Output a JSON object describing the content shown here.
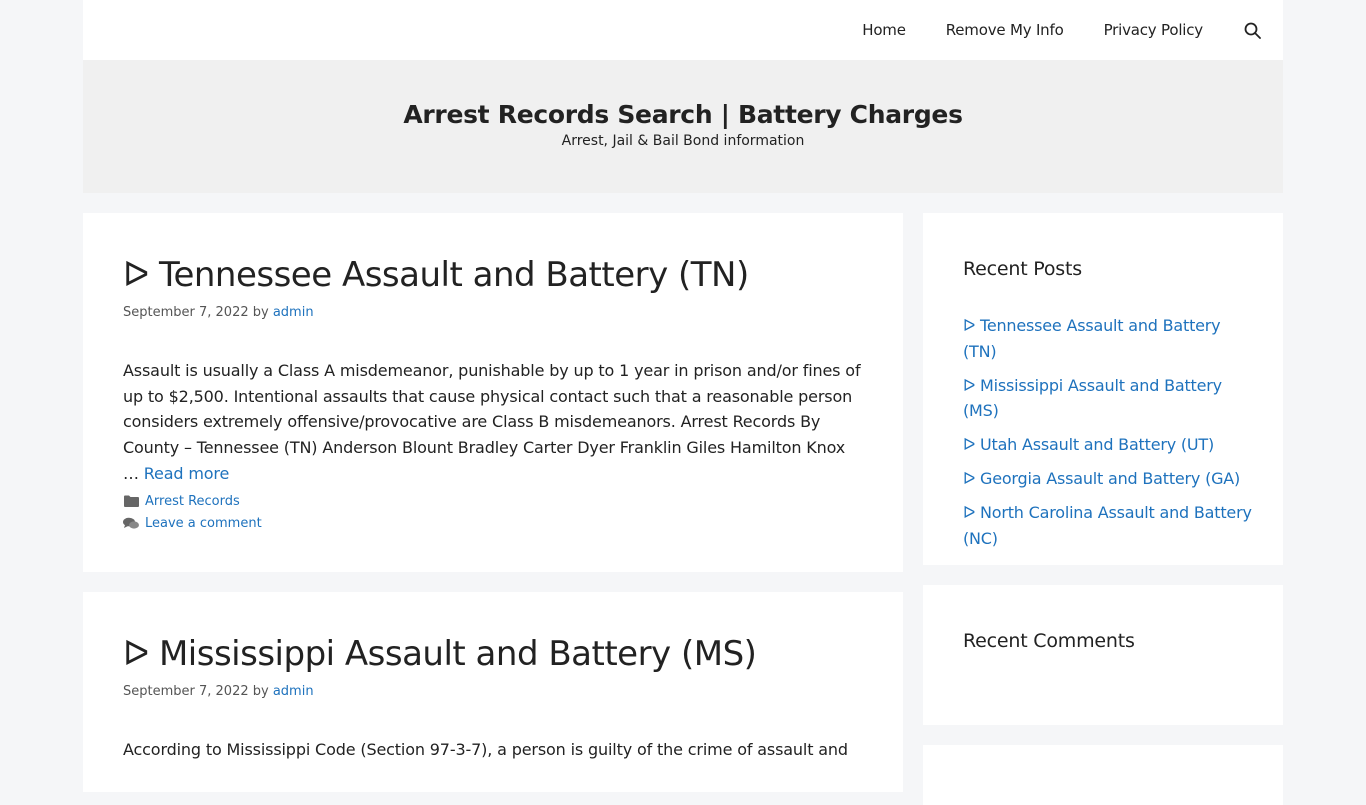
{
  "nav": {
    "items": [
      "Home",
      "Remove My Info",
      "Privacy Policy"
    ],
    "search_icon": "search-icon"
  },
  "header": {
    "title": "Arrest Records Search | Battery Charges",
    "description": "Arrest, Jail & Bail Bond information"
  },
  "posts": [
    {
      "title": "ᐅ Tennessee Assault and Battery (TN)",
      "date": "September 7, 2022",
      "by": "by",
      "author": "admin",
      "excerpt": "Assault is usually a Class A misdemeanor, punishable by up to 1 year in prison and/or fines of up to $2,500. Intentional assaults that cause physical contact such that a reasonable person considers extremely offensive/provocative are Class B misdemeanors. Arrest Records By County – Tennessee (TN) Anderson  Blount  Bradley  Carter  Dyer  Franklin  Giles  Hamilton  Knox  … ",
      "read_more": "Read more",
      "category": "Arrest Records",
      "comment_link": "Leave a comment"
    },
    {
      "title": "ᐅ Mississippi Assault and Battery (MS)",
      "date": "September 7, 2022",
      "by": "by",
      "author": "admin",
      "excerpt": "According to Mississippi Code (Section 97-3-7), a person is guilty of the crime of assault and"
    }
  ],
  "sidebar": {
    "recent_posts_title": "Recent Posts",
    "recent_posts": [
      "ᐅ Tennessee Assault and Battery (TN)",
      "ᐅ Mississippi Assault and Battery (MS)",
      "ᐅ Utah Assault and Battery (UT)",
      "ᐅ Georgia Assault and Battery (GA)",
      "ᐅ North Carolina Assault and Battery (NC)"
    ],
    "recent_comments_title": "Recent Comments"
  },
  "colors": {
    "link": "#1e72bd",
    "page_bg": "#f5f6f8",
    "header_bg": "#f0f0f0"
  }
}
